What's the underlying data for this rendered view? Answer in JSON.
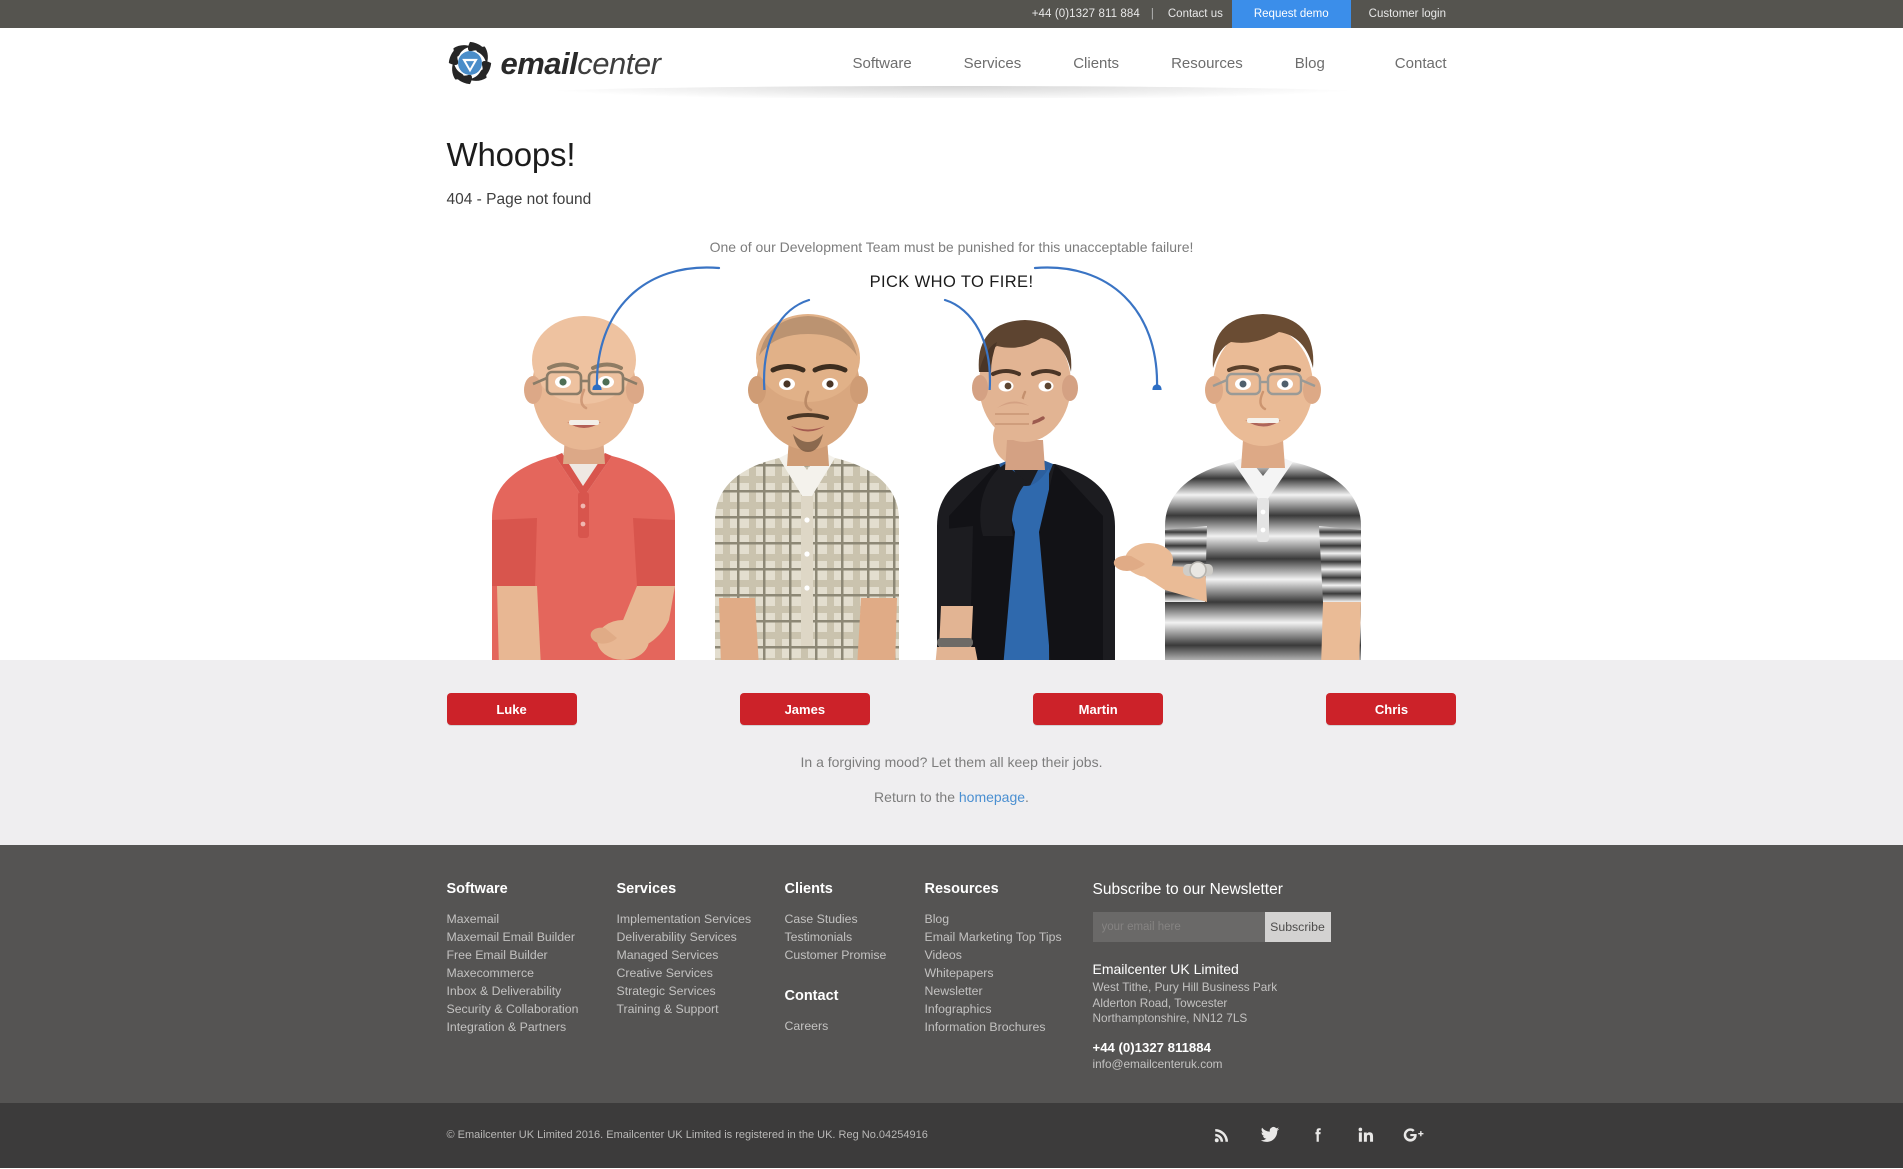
{
  "topbar": {
    "phone": "+44 (0)1327 811 884",
    "separator": "|",
    "contact_label": "Contact us",
    "demo_label": "Request demo",
    "login_label": "Customer login",
    "demo_bg": "#3b8eea",
    "bg": "#55544f"
  },
  "header": {
    "logo_bold": "email",
    "logo_light": "center",
    "nav": [
      {
        "label": "Software"
      },
      {
        "label": "Services"
      },
      {
        "label": "Clients"
      },
      {
        "label": "Resources"
      },
      {
        "label": "Blog"
      },
      {
        "label": "Contact"
      }
    ]
  },
  "main": {
    "title": "Whoops!",
    "subtitle": "404 - Page not found",
    "punish_text": "One of our Development Team must be punished for this unacceptable failure!",
    "pick_heading": "PICK WHO TO FIRE!",
    "arrow_color": "#3a74c4",
    "people": [
      {
        "name": "Luke",
        "shirt": "#e4665c",
        "shirt_alt": "coral polo shirt",
        "skin": "#e8b793",
        "hair": "bald",
        "glasses": true
      },
      {
        "name": "James",
        "shirt": "#d8d2c4",
        "shirt_alt": "checked shirt",
        "skin": "#d9a77f",
        "hair": "bald",
        "glasses": false
      },
      {
        "name": "Martin",
        "shirt": "#1c1c20",
        "shirt_alt": "black jacket over blue t-shirt",
        "skin": "#e2b493",
        "hair": "#5d4430",
        "glasses": false
      },
      {
        "name": "Chris",
        "shirt": "#e8e8e8",
        "shirt_alt": "striped polo shirt",
        "skin": "#eabb96",
        "hair": "#6a4c33",
        "glasses": true
      }
    ]
  },
  "choose": {
    "buttons": [
      "Luke",
      "James",
      "Martin",
      "Chris"
    ],
    "button_color": "#cc2229",
    "forgiving_text": "In a forgiving mood? Let them all keep their jobs.",
    "return_prefix": "Return to the ",
    "return_link": "homepage",
    "return_suffix": ".",
    "bg": "#efeef0"
  },
  "footer": {
    "bg": "#555453",
    "columns": {
      "software": {
        "heading": "Software",
        "links": [
          "Maxemail",
          "Maxemail Email Builder",
          "Free Email Builder",
          "Maxecommerce",
          "Inbox & Deliverability",
          "Security & Collaboration",
          "Integration & Partners"
        ]
      },
      "services": {
        "heading": "Services",
        "links": [
          "Implementation Services",
          "Deliverability Services",
          "Managed Services",
          "Creative Services",
          "Strategic Services",
          "Training & Support"
        ]
      },
      "clients": {
        "heading": "Clients",
        "links": [
          "Case Studies",
          "Testimonials",
          "Customer Promise"
        ],
        "heading2": "Contact",
        "links2": [
          "Careers"
        ]
      },
      "resources": {
        "heading": "Resources",
        "links": [
          "Blog",
          "Email Marketing Top Tips",
          "Videos",
          "Whitepapers",
          "Newsletter",
          "Infographics",
          "Information Brochures"
        ]
      }
    },
    "newsletter": {
      "title": "Subscribe to our Newsletter",
      "placeholder": "your email here",
      "value": "",
      "button": "Subscribe"
    },
    "company": {
      "name": "Emailcenter UK Limited",
      "address_line1": "West Tithe, Pury Hill Business Park",
      "address_line2": "Alderton Road, Towcester",
      "address_line3": "Northamptonshire, NN12 7LS",
      "phone": "+44 (0)1327 811884",
      "email": "info@emailcenteruk.com"
    }
  },
  "bottombar": {
    "bg": "#3c3b3b",
    "copyright": "© Emailcenter UK Limited 2016. Emailcenter UK Limited is registered in the UK. Reg No.04254916",
    "socials": [
      "rss-icon",
      "twitter-icon",
      "facebook-icon",
      "linkedin-icon",
      "googleplus-icon"
    ]
  }
}
